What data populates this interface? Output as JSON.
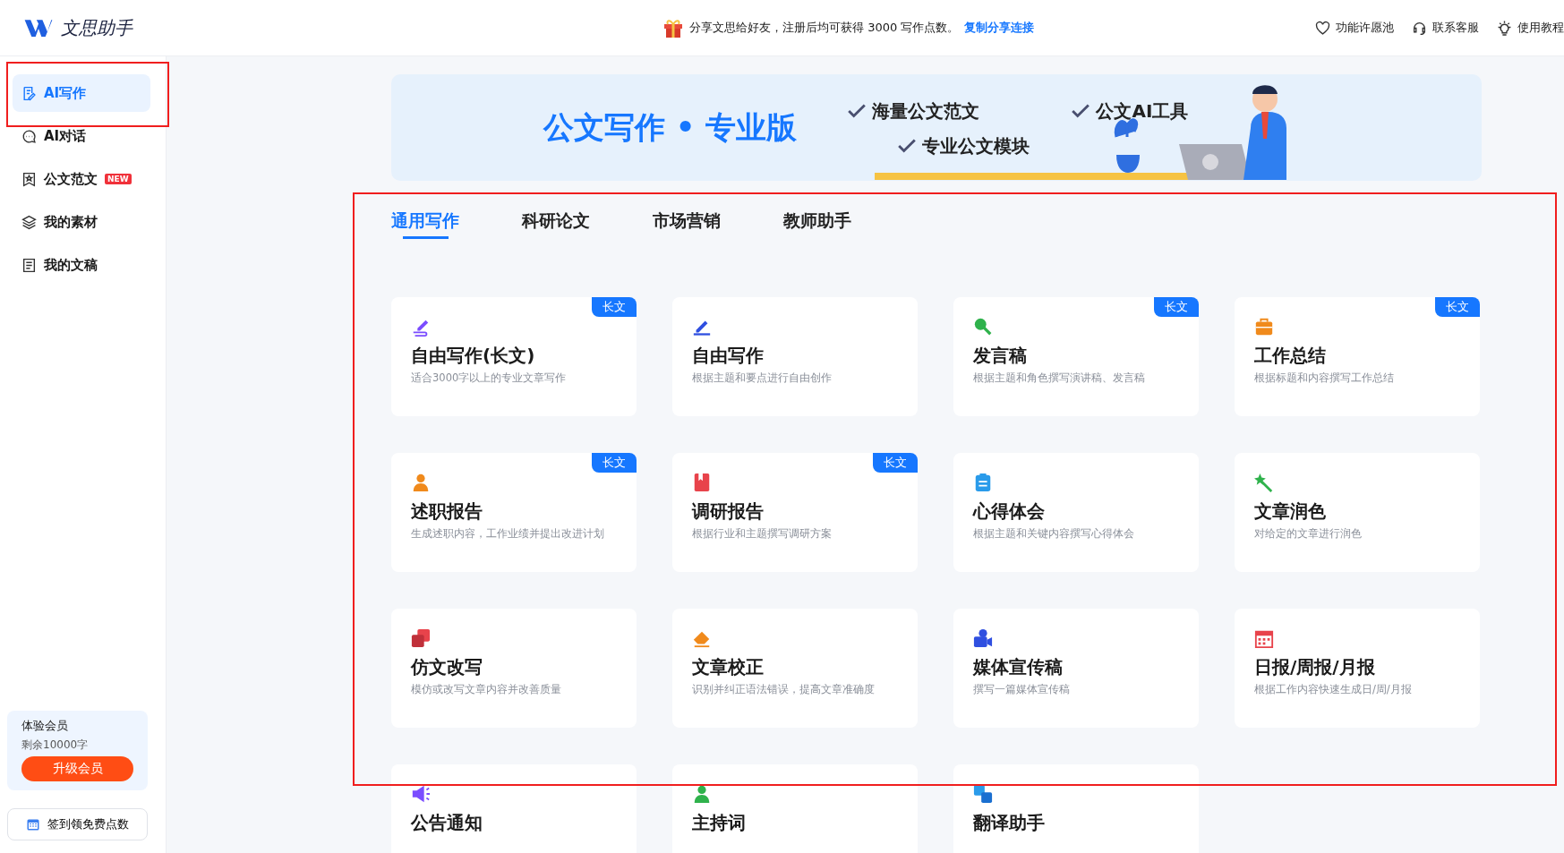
{
  "header": {
    "logo_text": "文思助手",
    "notice": "分享文思给好友，注册后均可获得 3000 写作点数。",
    "notice_link": "复制分享连接",
    "links": [
      "功能许愿池",
      "联系客服",
      "使用教程"
    ]
  },
  "sidebar": {
    "items": [
      {
        "label": "AI写作",
        "selected": true
      },
      {
        "label": "AI对话",
        "selected": false
      },
      {
        "label": "公文范文",
        "selected": false,
        "badge": "NEW"
      },
      {
        "label": "我的素材",
        "selected": false
      },
      {
        "label": "我的文稿",
        "selected": false
      }
    ],
    "membership": {
      "title": "体验会员",
      "remaining": "剩余10000字",
      "button": "升级会员"
    },
    "checkin": "签到领免费点数"
  },
  "banner": {
    "title": "公文写作 • 专业版",
    "features": [
      "海量公文范文",
      "公文AI工具",
      "专业公文模块"
    ]
  },
  "tabs": [
    {
      "label": "通用写作",
      "selected": true
    },
    {
      "label": "科研论文",
      "selected": false
    },
    {
      "label": "市场营销",
      "selected": false
    },
    {
      "label": "教师助手",
      "selected": false
    }
  ],
  "cards": [
    {
      "title": "自由写作(长文)",
      "description": "适合3000字以上的专业文章写作",
      "badge": "长文"
    },
    {
      "title": "自由写作",
      "description": "根据主题和要点进行自由创作"
    },
    {
      "title": "发言稿",
      "description": "根据主题和角色撰写演讲稿、发言稿",
      "badge": "长文"
    },
    {
      "title": "工作总结",
      "description": "根据标题和内容撰写工作总结",
      "badge": "长文"
    },
    {
      "title": "述职报告",
      "description": "生成述职内容，工作业绩并提出改进计划",
      "badge": "长文"
    },
    {
      "title": "调研报告",
      "description": "根据行业和主题撰写调研方案",
      "badge": "长文"
    },
    {
      "title": "心得体会",
      "description": "根据主题和关键内容撰写心得体会"
    },
    {
      "title": "文章润色",
      "description": "对给定的文章进行润色"
    },
    {
      "title": "仿文改写",
      "description": "模仿或改写文章内容并改善质量"
    },
    {
      "title": "文章校正",
      "description": "识别并纠正语法错误，提高文章准确度"
    },
    {
      "title": "媒体宣传稿",
      "description": "撰写一篇媒体宣传稿"
    },
    {
      "title": "日报/周报/月报",
      "description": "根据工作内容快速生成日/周/月报"
    },
    {
      "title": "公告通知"
    },
    {
      "title": "主持词"
    },
    {
      "title": "翻译助手"
    }
  ]
}
